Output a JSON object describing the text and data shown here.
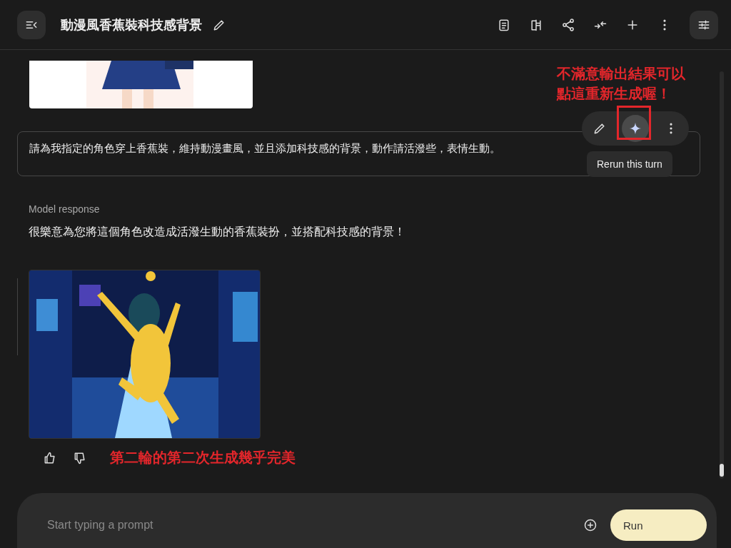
{
  "header": {
    "title": "動漫風香蕉裝科技感背景"
  },
  "prompt_turn": {
    "text": "請為我指定的角色穿上香蕉裝，維持動漫畫風，並且添加科技感的背景，動作請活潑些，表情生動。",
    "tooltip": "Rerun this turn"
  },
  "annotation_top": [
    "不滿意輸出結果可以",
    "點這重新生成喔！"
  ],
  "response": {
    "label": "Model response",
    "text": "很樂意為您將這個角色改造成活潑生動的香蕉裝扮，並搭配科技感的背景！"
  },
  "annotation_bottom": "第二輪的第二次生成幾乎完美",
  "prompt_bar": {
    "placeholder": "Start typing a prompt",
    "run_label": "Run"
  }
}
